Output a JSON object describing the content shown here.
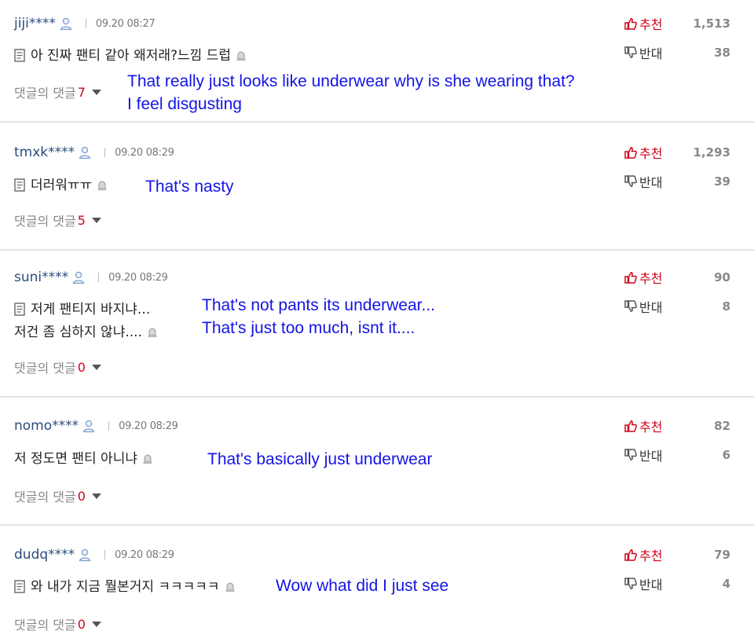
{
  "labels": {
    "recommend": "추천",
    "oppose": "반대",
    "reply_prefix": "댓글의 댓글"
  },
  "colors": {
    "username": "#2b4c7e",
    "recommend": "#d0021b",
    "reply_count": "#d0021b",
    "translation": "#1414e6",
    "divider": "#e3e3e3"
  },
  "icons": {
    "user": "user-icon",
    "document": "document-icon",
    "report": "report-icon",
    "thumbs_up": "thumbs-up-icon",
    "thumbs_down": "thumbs-down-icon",
    "expand": "chevron-down-icon"
  },
  "comments": [
    {
      "user": "jiji****",
      "date": "09.20 08:27",
      "text": [
        "아 진짜 팬티 같아 왜저래?느낌 드럽"
      ],
      "translation": [
        "That really just looks like underwear why is she wearing that?",
        "I feel disgusting"
      ],
      "replies": "7",
      "up": "1,513",
      "down": "38"
    },
    {
      "user": "tmxk****",
      "date": "09.20 08:29",
      "text": [
        "더러워ㅠㅠ"
      ],
      "translation": [
        "That's nasty"
      ],
      "replies": "5",
      "up": "1,293",
      "down": "39"
    },
    {
      "user": "suni****",
      "date": "09.20 08:29",
      "text": [
        "저게 팬티지 바지냐...",
        "저건 좀 심하지 않냐...."
      ],
      "translation": [
        "That's not pants its underwear...",
        "That's just too much, isnt it...."
      ],
      "replies": "0",
      "up": "90",
      "down": "8"
    },
    {
      "user": "nomo****",
      "date": "09.20 08:29",
      "text": [
        "저 정도면 팬티 아니냐"
      ],
      "translation": [
        "That's basically just underwear"
      ],
      "replies": "0",
      "up": "82",
      "down": "6"
    },
    {
      "user": "dudq****",
      "date": "09.20 08:29",
      "text": [
        "와 내가 지금 뭘본거지 ㅋㅋㅋㅋㅋ"
      ],
      "translation": [
        "Wow what did I just see"
      ],
      "replies": "0",
      "up": "79",
      "down": "4"
    }
  ]
}
